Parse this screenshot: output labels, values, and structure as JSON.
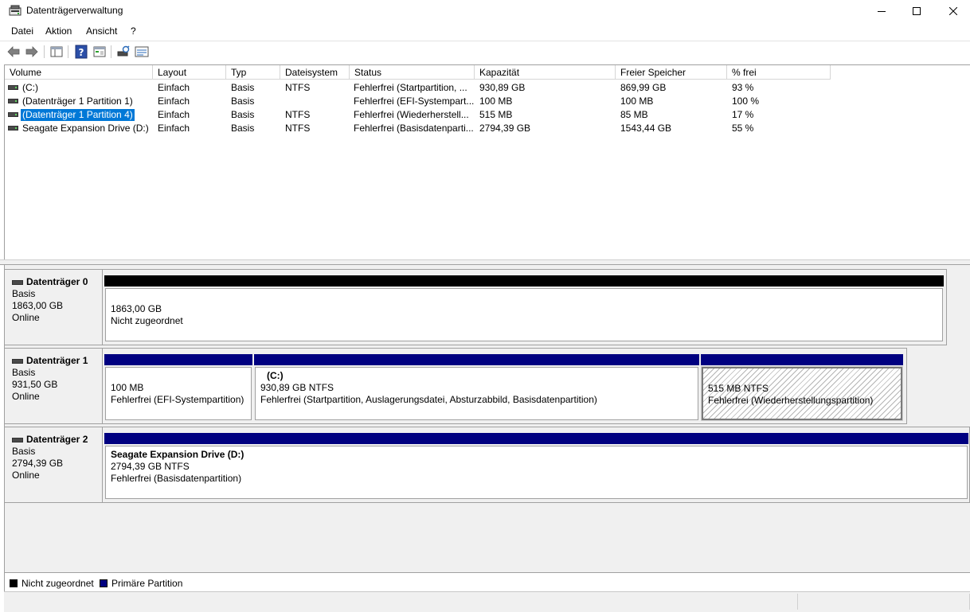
{
  "window": {
    "title": "Datenträgerverwaltung"
  },
  "menu": {
    "items": [
      "Datei",
      "Aktion",
      "Ansicht",
      "?"
    ]
  },
  "toolbar": {
    "buttons": [
      "back-icon",
      "forward-icon",
      "console-tree-icon",
      "help-icon",
      "properties-icon",
      "rescan-icon",
      "disk-list-icon"
    ]
  },
  "table": {
    "headers": [
      "Volume",
      "Layout",
      "Typ",
      "Dateisystem",
      "Status",
      "Kapazität",
      "Freier Speicher",
      "% frei"
    ],
    "rows": [
      [
        "(C:)",
        "Einfach",
        "Basis",
        "NTFS",
        "Fehlerfrei (Startpartition, ...",
        "930,89 GB",
        "869,99 GB",
        "93 %"
      ],
      [
        "(Datenträger 1 Partition 1)",
        "Einfach",
        "Basis",
        "",
        "Fehlerfrei (EFI-Systempart...",
        "100 MB",
        "100 MB",
        "100 %"
      ],
      [
        "(Datenträger 1 Partition 4)",
        "Einfach",
        "Basis",
        "NTFS",
        "Fehlerfrei (Wiederherstell...",
        "515 MB",
        "85 MB",
        "17 %"
      ],
      [
        "Seagate Expansion Drive (D:)",
        "Einfach",
        "Basis",
        "NTFS",
        "Fehlerfrei (Basisdatenparti...",
        "2794,39 GB",
        "1543,44 GB",
        "55 %"
      ]
    ],
    "selected_row": 2
  },
  "disks": [
    {
      "name": "Datenträger 0",
      "type": "Basis",
      "size": "1863,00 GB",
      "state": "Online",
      "partitions": [
        {
          "title": "",
          "line1": "1863,00 GB",
          "line2": "Nicht zugeordnet"
        }
      ]
    },
    {
      "name": "Datenträger 1",
      "type": "Basis",
      "size": "931,50 GB",
      "state": "Online",
      "partitions": [
        {
          "title": "",
          "line1": "100 MB",
          "line2": "Fehlerfrei (EFI-Systempartition)"
        },
        {
          "title": "(C:)",
          "line1": "930,89 GB NTFS",
          "line2": "Fehlerfrei (Startpartition, Auslagerungsdatei, Absturzabbild, Basisdatenpartition)"
        },
        {
          "title": "",
          "line1": "515 MB NTFS",
          "line2": "Fehlerfrei (Wiederherstellungspartition)"
        }
      ]
    },
    {
      "name": "Datenträger 2",
      "type": "Basis",
      "size": "2794,39 GB",
      "state": "Online",
      "partitions": [
        {
          "title": "Seagate Expansion Drive  (D:)",
          "line1": "2794,39 GB NTFS",
          "line2": "Fehlerfrei (Basisdatenpartition)"
        }
      ]
    }
  ],
  "legend": {
    "unallocated": {
      "label": "Nicht zugeordnet",
      "color": "#000000"
    },
    "primary": {
      "label": "Primäre Partition",
      "color": "#000080"
    }
  }
}
